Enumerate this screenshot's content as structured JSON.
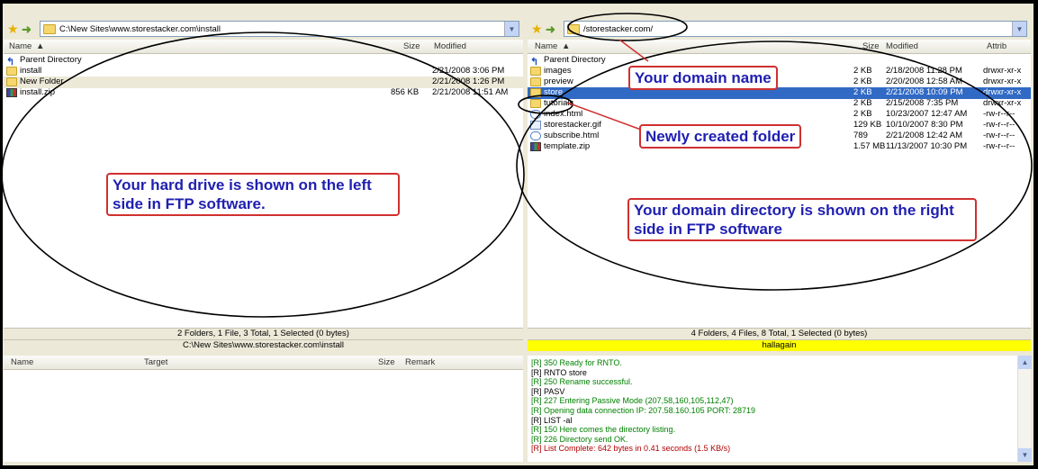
{
  "left": {
    "path": "C:\\New Sites\\www.storestacker.com\\install",
    "columns": {
      "name": "Name",
      "size": "Size",
      "modified": "Modified"
    },
    "files": [
      {
        "name": "Parent Directory",
        "size": "",
        "modified": "",
        "icon": "parent-dir-icon"
      },
      {
        "name": "install",
        "size": "",
        "modified": "2/21/2008 3:06 PM",
        "icon": "folder-icon"
      },
      {
        "name": "New Folder",
        "size": "",
        "modified": "2/21/2008 1:26 PM",
        "icon": "folder-icon"
      },
      {
        "name": "install.zip",
        "size": "856 KB",
        "modified": "2/21/2008 11:51 AM",
        "icon": "zip-icon"
      }
    ],
    "status": "2 Folders, 1 File, 3 Total, 1 Selected (0 bytes)",
    "status_path": "C:\\New Sites\\www.storestacker.com\\install"
  },
  "right": {
    "path": "/storestacker.com/",
    "columns": {
      "name": "Name",
      "size": "Size",
      "modified": "Modified",
      "attrib": "Attrib"
    },
    "files": [
      {
        "name": "Parent Directory",
        "size": "",
        "modified": "",
        "attrib": "",
        "icon": "parent-dir-icon"
      },
      {
        "name": "images",
        "size": "2 KB",
        "modified": "2/18/2008 11:28 PM",
        "attrib": "drwxr-xr-x",
        "icon": "folder-icon"
      },
      {
        "name": "preview",
        "size": "2 KB",
        "modified": "2/20/2008 12:58 AM",
        "attrib": "drwxr-xr-x",
        "icon": "folder-icon"
      },
      {
        "name": "store",
        "size": "2 KB",
        "modified": "2/21/2008 10:09 PM",
        "attrib": "drwxr-xr-x",
        "icon": "folder-icon"
      },
      {
        "name": "tutorials",
        "size": "2 KB",
        "modified": "2/15/2008 7:35 PM",
        "attrib": "drwxr-xr-x",
        "icon": "folder-icon"
      },
      {
        "name": "index.html",
        "size": "2 KB",
        "modified": "10/23/2007 12:47 AM",
        "attrib": "-rw-r--r--",
        "icon": "html-icon"
      },
      {
        "name": "storestacker.gif",
        "size": "129 KB",
        "modified": "10/10/2007 8:30 PM",
        "attrib": "-rw-r--r--",
        "icon": "gif-icon"
      },
      {
        "name": "subscribe.html",
        "size": "789",
        "modified": "2/21/2008 12:42 AM",
        "attrib": "-rw-r--r--",
        "icon": "html-icon"
      },
      {
        "name": "template.zip",
        "size": "1.57 MB",
        "modified": "11/13/2007 10:30 PM",
        "attrib": "-rw-r--r--",
        "icon": "zip-icon"
      }
    ],
    "status": "4 Folders, 4 Files, 8 Total, 1 Selected (0 bytes)",
    "status_host": "hallagain"
  },
  "queue": {
    "columns": {
      "name": "Name",
      "target": "Target",
      "size": "Size",
      "remark": "Remark"
    }
  },
  "log": [
    {
      "text": "[R] 350 Ready for RNTO.",
      "color": "green"
    },
    {
      "text": "[R] RNTO store",
      "color": "black"
    },
    {
      "text": "[R] 250 Rename successful.",
      "color": "green"
    },
    {
      "text": "[R] PASV",
      "color": "black"
    },
    {
      "text": "[R] 227 Entering Passive Mode (207,58,160,105,112,47)",
      "color": "green"
    },
    {
      "text": "[R] Opening data connection IP: 207.58.160.105 PORT: 28719",
      "color": "green"
    },
    {
      "text": "[R] LIST -al",
      "color": "black"
    },
    {
      "text": "[R] 150 Here comes the directory listing.",
      "color": "green"
    },
    {
      "text": "[R] 226 Directory send OK.",
      "color": "green"
    },
    {
      "text": "[R] List Complete: 642 bytes in 0.41 seconds (1.5 KB/s)",
      "color": "red"
    }
  ],
  "annotations": {
    "domain_name": "Your domain name",
    "new_folder": "Newly created folder",
    "hard_drive": "Your hard drive is shown on the left side in FTP software.",
    "domain_dir": "Your domain directory is shown on the right side in FTP software"
  }
}
